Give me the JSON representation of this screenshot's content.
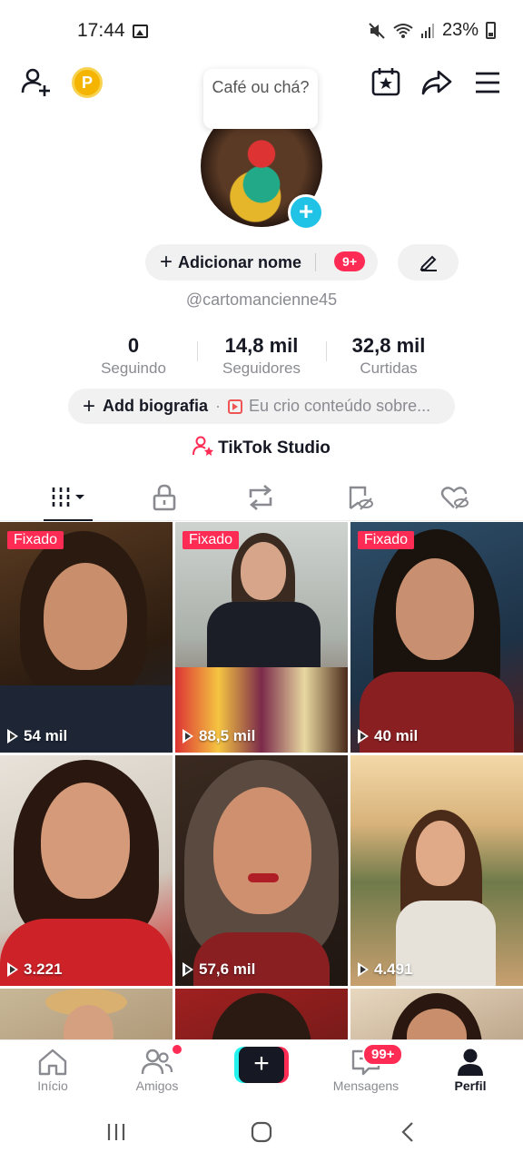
{
  "status_bar": {
    "time": "17:44",
    "battery": "23%"
  },
  "profile": {
    "bubble_text": "Café ou chá?",
    "add_name_label": "Adicionar nome",
    "add_name_badge": "9+",
    "username": "@cartomancienne45",
    "stats": [
      {
        "value": "0",
        "label": "Seguindo"
      },
      {
        "value": "14,8 mil",
        "label": "Seguidores"
      },
      {
        "value": "32,8 mil",
        "label": "Curtidas"
      }
    ],
    "add_bio_label": "Add biografia",
    "bio_prompt": "Eu crio conteúdo sobre...",
    "studio_label": "TikTok Studio"
  },
  "videos": [
    {
      "pinned": "Fixado",
      "views": "54 mil"
    },
    {
      "pinned": "Fixado",
      "views": "88,5 mil"
    },
    {
      "pinned": "Fixado",
      "views": "40 mil"
    },
    {
      "pinned": "",
      "views": "3.221"
    },
    {
      "pinned": "",
      "views": "57,6 mil"
    },
    {
      "pinned": "",
      "views": "4.491"
    }
  ],
  "bottom_nav": {
    "home": "Início",
    "friends": "Amigos",
    "messages": "Mensagens",
    "messages_badge": "99+",
    "profile": "Perfil"
  },
  "colors": {
    "accent": "#fe2c55",
    "cyan": "#25f4ee",
    "text": "#161823",
    "muted": "#8a8b91"
  }
}
